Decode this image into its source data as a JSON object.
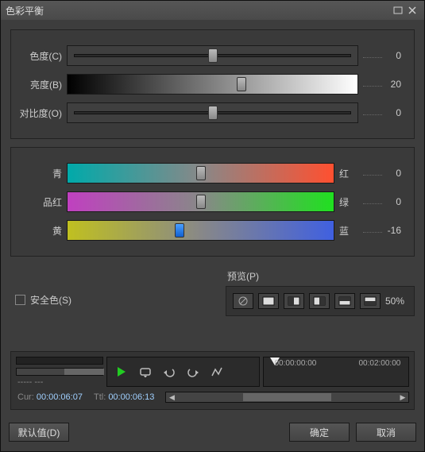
{
  "title": "色彩平衡",
  "sliders": {
    "hue": {
      "label": "色度(C)",
      "value": 0,
      "pos": 50
    },
    "brightness": {
      "label": "亮度(B)",
      "value": 20,
      "pos": 60
    },
    "contrast": {
      "label": "对比度(O)",
      "value": 0,
      "pos": 50
    }
  },
  "color_sliders": [
    {
      "left": "青",
      "right": "红",
      "value": 0,
      "pos": 50
    },
    {
      "left": "品红",
      "right": "绿",
      "value": 0,
      "pos": 50
    },
    {
      "left": "黄",
      "right": "蓝",
      "value": -16,
      "pos": 42
    }
  ],
  "safe_color_label": "安全色(S)",
  "preview": {
    "title": "预览(P)",
    "percent": "50%"
  },
  "timeline": {
    "ruler": [
      "00:00:00:00",
      "00:02:00:00"
    ],
    "cur_label": "Cur:",
    "cur": "00:00:06:07",
    "ttl_label": "Ttl:",
    "ttl": "00:00:06:13",
    "dashes": "-----  ---"
  },
  "buttons": {
    "defaults": "默认值(D)",
    "ok": "确定",
    "cancel": "取消"
  }
}
